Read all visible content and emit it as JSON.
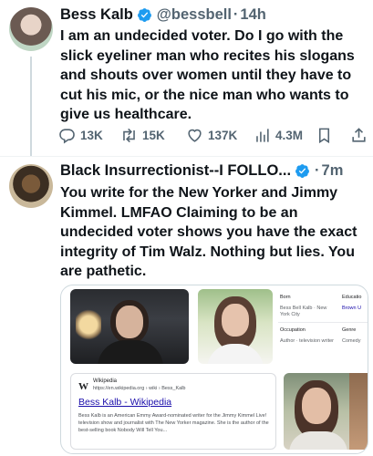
{
  "tweet1": {
    "name": "Bess Kalb",
    "handle": "@bessbell",
    "separator": "·",
    "time": "14h",
    "text": "I am an undecided voter. Do I go with the slick eyeliner man who recites his slogans and shouts over women until they have to cut his mic, or the nice man who wants to give us healthcare.",
    "replies": "13K",
    "retweets": "15K",
    "likes": "137K",
    "views": "4.3M",
    "icons": [
      "reply-icon",
      "retweet-icon",
      "like-icon",
      "views-icon",
      "bookmark-icon",
      "share-icon"
    ]
  },
  "tweet2": {
    "name": "Black Insurrectionist--I FOLLO...",
    "separator": "·",
    "time": "7m",
    "text": "You write for the New Yorker and Jimmy Kimmel. LMFAO Claiming to be an undecided voter shows you have the exact integrity of Tim Walz. Nothing but lies. You are pathetic."
  },
  "media": {
    "info_panel": {
      "born_label": "Born",
      "born_value": "Bess Bell Kalb · New York City",
      "education_label": "Educatio",
      "education_value": "Brown U",
      "occupation_label": "Occupation",
      "occupation_value": "Author · television writer",
      "genre_label": "Genre",
      "genre_value": "Comedy"
    },
    "wiki": {
      "site": "Wikipedia",
      "url": "https://en.wikipedia.org › wiki › Bess_Kalb",
      "title": "Bess Kalb - Wikipedia",
      "snippet": "Bess Kalb is an American Emmy Award-nominated writer for the Jimmy Kimmel Live! television show and journalist with The New Yorker magazine. She is the author of the best-selling book Nobody Will Tell You..."
    }
  },
  "colors": {
    "text": "#0f1419",
    "muted": "#536471",
    "verified": "#1d9bf0",
    "link": "#1a0dab"
  }
}
